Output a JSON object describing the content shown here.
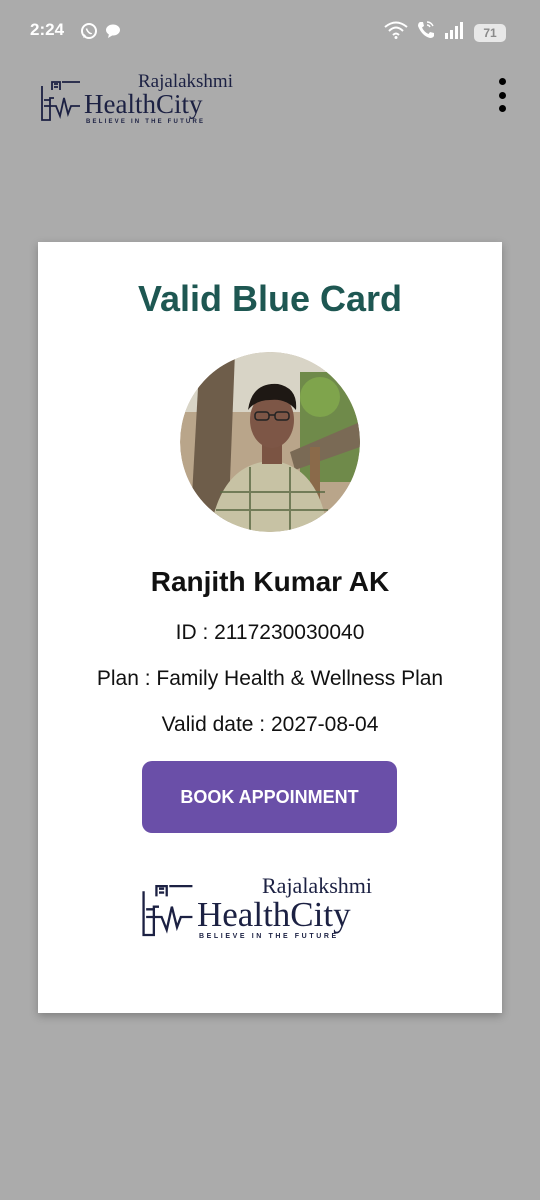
{
  "status_bar": {
    "time": "2:24",
    "battery": "71",
    "left_icons": [
      "whatsapp-icon",
      "chat-icon"
    ],
    "right_icons": [
      "wifi-icon",
      "wifi-call-icon",
      "signal-icon",
      "battery-icon"
    ]
  },
  "header": {
    "logo": {
      "top": "Rajalakshmi",
      "main": "HealthCity",
      "tagline": "BELIEVE IN THE FUTURE"
    },
    "menu_icon": "more-vertical-icon"
  },
  "card": {
    "title": "Valid Blue Card",
    "name": "Ranjith Kumar AK",
    "id_text": "ID : 2117230030040",
    "plan_text": "Plan :  Family Health & Wellness Plan",
    "valid_text": "Valid date : 2027-08-04",
    "button_label": "BOOK APPOINMENT",
    "footer_logo": {
      "top": "Rajalakshmi",
      "main": "HealthCity",
      "tagline": "BELIEVE IN THE FUTURE"
    }
  },
  "colors": {
    "background": "#ababab",
    "title": "#1e5752",
    "button": "#6a4fa8",
    "logo": "#1c2143"
  }
}
